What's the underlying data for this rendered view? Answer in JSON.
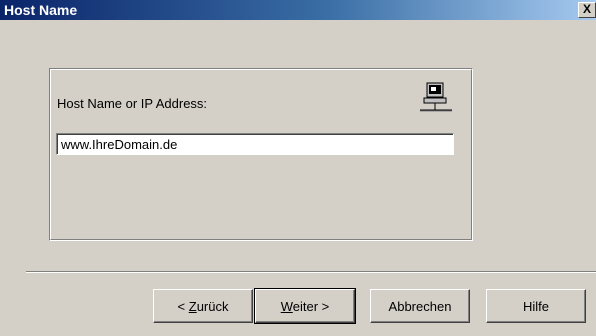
{
  "window": {
    "title": "Host Name",
    "close_label": "X"
  },
  "group": {
    "label": "Host Name or IP Address:",
    "host_value": "www.IhreDomain.de",
    "icon": "computer-icon"
  },
  "buttons": {
    "back": {
      "prefix": "< ",
      "accel": "Z",
      "rest": "urück"
    },
    "next": {
      "accel": "W",
      "rest": "eiter >"
    },
    "cancel": "Abbrechen",
    "help": "Hilfe"
  }
}
